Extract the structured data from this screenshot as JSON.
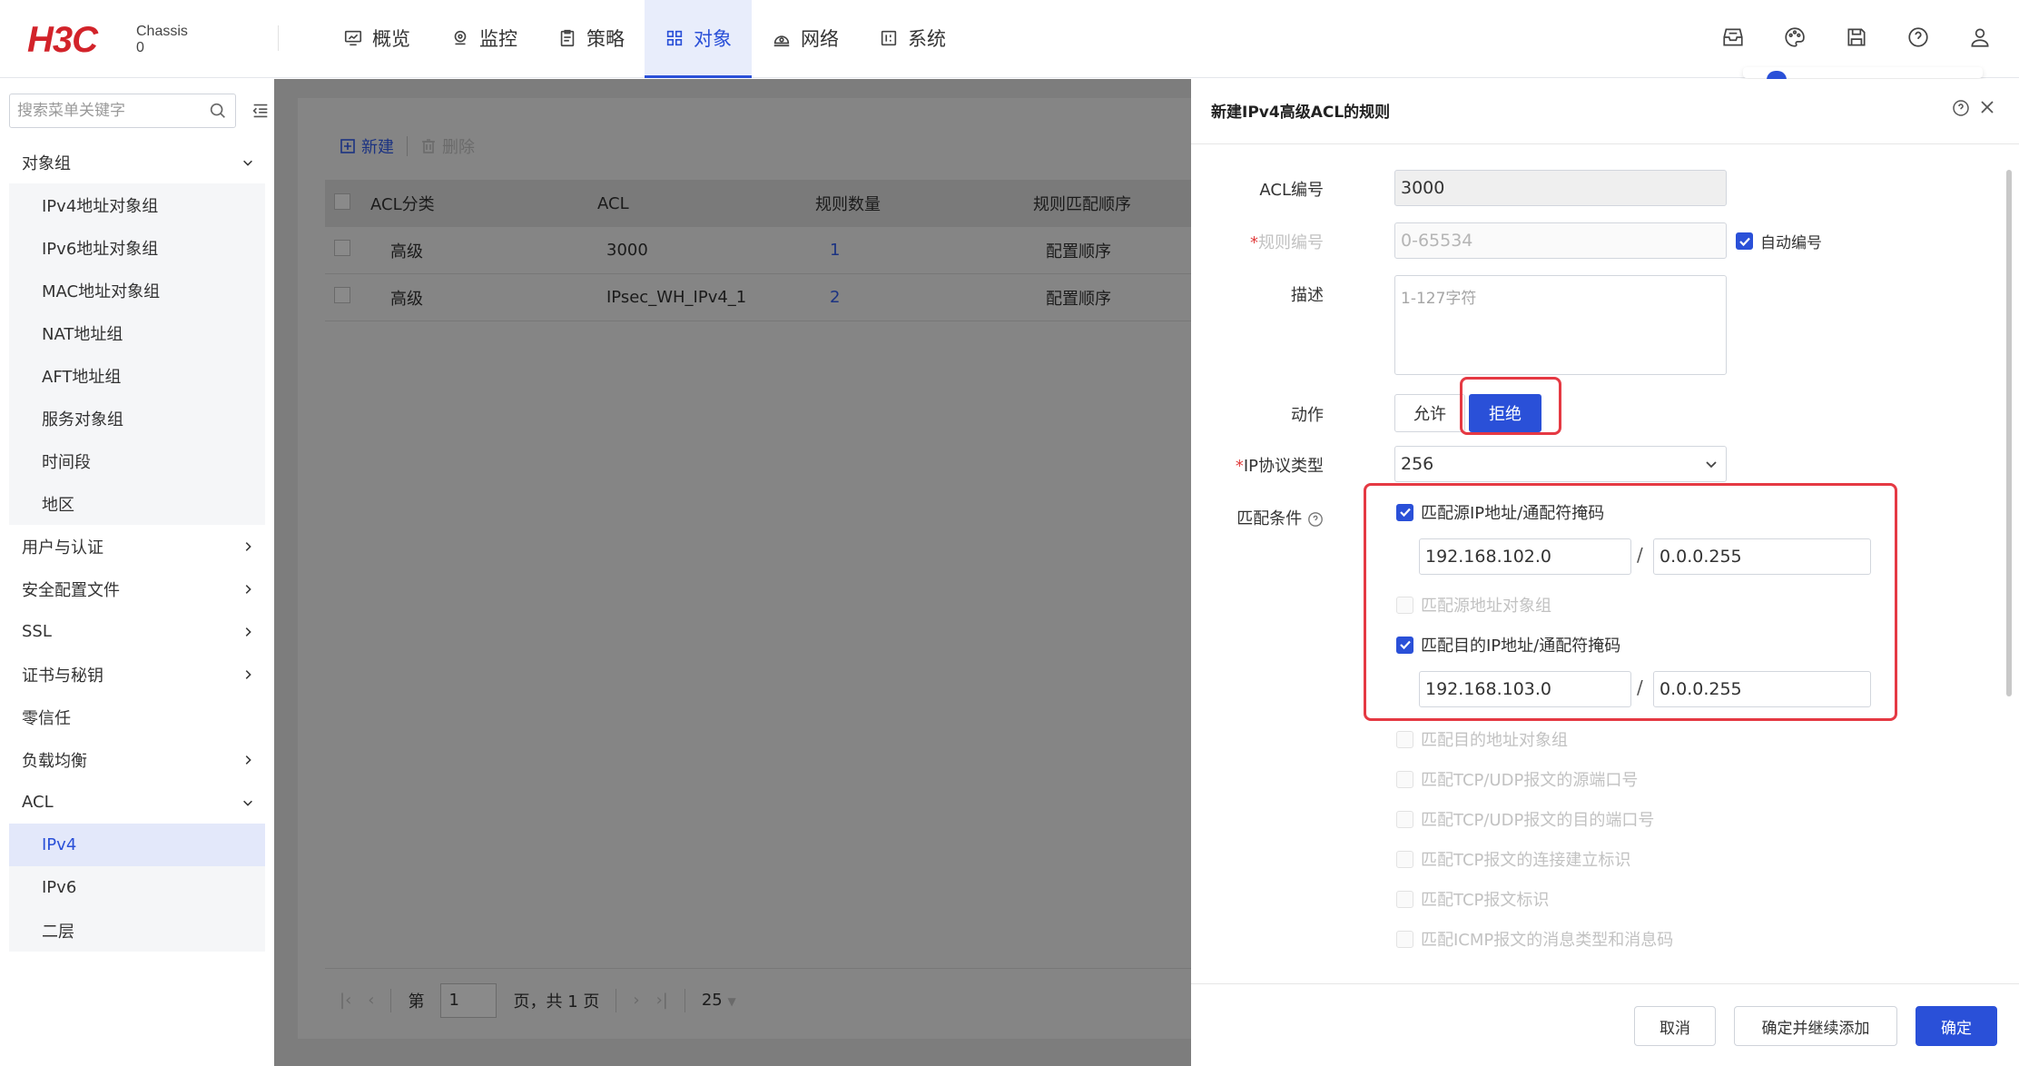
{
  "header": {
    "logo": "H3C",
    "chassis_line1": "Chassis",
    "chassis_line2": "0",
    "nav": [
      {
        "label": "概览",
        "icon": "monitor-chart-icon"
      },
      {
        "label": "监控",
        "icon": "location-pin-icon"
      },
      {
        "label": "策略",
        "icon": "clipboard-icon"
      },
      {
        "label": "对象",
        "icon": "grid-icon"
      },
      {
        "label": "网络",
        "icon": "network-icon"
      },
      {
        "label": "系统",
        "icon": "system-icon"
      }
    ],
    "active_nav": "对象",
    "right_icons": [
      "inbox-icon",
      "palette-icon",
      "save-icon",
      "help-icon",
      "user-icon"
    ]
  },
  "sidebar": {
    "search_placeholder": "搜索菜单关键字",
    "groups": [
      {
        "label": "对象组",
        "expanded": true,
        "children": [
          "IPv4地址对象组",
          "IPv6地址对象组",
          "MAC地址对象组",
          "NAT地址组",
          "AFT地址组",
          "服务对象组",
          "时间段",
          "地区"
        ]
      },
      {
        "label": "用户与认证",
        "expanded": false
      },
      {
        "label": "安全配置文件",
        "expanded": false
      },
      {
        "label": "SSL",
        "expanded": false
      },
      {
        "label": "证书与秘钥",
        "expanded": false
      },
      {
        "label": "零信任",
        "expanded": false
      },
      {
        "label": "负载均衡",
        "expanded": false
      },
      {
        "label": "ACL",
        "expanded": true,
        "children": [
          "IPv4",
          "IPv6",
          "二层"
        ]
      }
    ],
    "selected": "IPv4"
  },
  "main": {
    "toolbar": {
      "new_label": "新建",
      "delete_label": "删除"
    },
    "table": {
      "columns": [
        "ACL分类",
        "ACL",
        "规则数量",
        "规则匹配顺序"
      ],
      "rows": [
        [
          "高级",
          "3000",
          "1",
          "配置顺序"
        ],
        [
          "高级",
          "IPsec_WH_IPv4_1",
          "2",
          "配置顺序"
        ]
      ]
    },
    "pager": {
      "prefix": "第",
      "page": "1",
      "suffix": "页，共 1 页",
      "page_size": "25"
    }
  },
  "drawer": {
    "title": "新建IPv4高级ACL的规则",
    "fields": {
      "acl_number_label": "ACL编号",
      "acl_number_value": "3000",
      "rule_number_label": "规则编号",
      "rule_number_placeholder": "0-65534",
      "auto_number_label": "自动编号",
      "description_label": "描述",
      "description_placeholder": "1-127字符",
      "action_label": "动作",
      "action_allow": "允许",
      "action_deny": "拒绝",
      "protocol_label": "IP协议类型",
      "protocol_value": "256",
      "match_label": "匹配条件"
    },
    "match": {
      "src_ip_label": "匹配源IP地址/通配符掩码",
      "src_ip": "192.168.102.0",
      "src_mask": "0.0.0.255",
      "src_obj_label": "匹配源地址对象组",
      "dst_ip_label": "匹配目的IP地址/通配符掩码",
      "dst_ip": "192.168.103.0",
      "dst_mask": "0.0.0.255",
      "dst_obj_label": "匹配目的地址对象组",
      "src_port_label": "匹配TCP/UDP报文的源端口号",
      "dst_port_label": "匹配TCP/UDP报文的目的端口号",
      "tcp_est_label": "匹配TCP报文的连接建立标识",
      "tcp_flag_label": "匹配TCP报文标识",
      "icmp_label": "匹配ICMP报文的消息类型和消息码"
    },
    "footer": {
      "cancel": "取消",
      "confirm_continue": "确定并继续添加",
      "confirm": "确定"
    }
  },
  "colors": {
    "accent": "#2a50d8",
    "highlight": "#e53943",
    "logo": "#d2232a"
  }
}
